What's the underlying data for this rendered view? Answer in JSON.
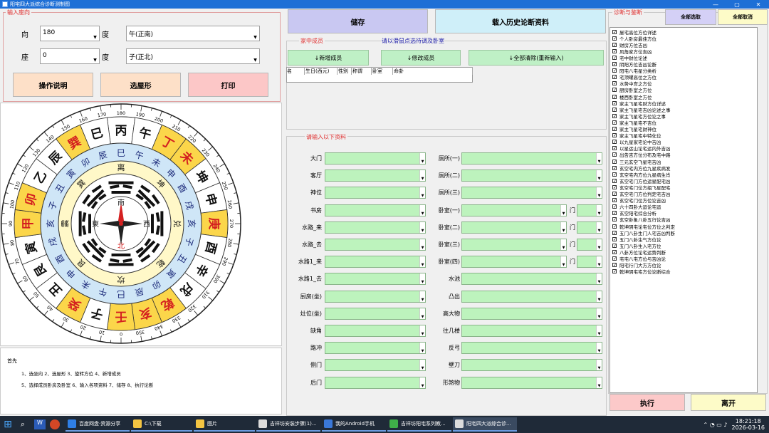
{
  "window": {
    "title": "阳宅四大派综合诊断测制图"
  },
  "input_group": {
    "title": "输入座向",
    "labels": [
      "向",
      "座"
    ],
    "du_label": "度",
    "xiang_value": "180",
    "xiang_dir": "午(正南)",
    "zuo_value": "0",
    "zuo_dir": "子(正北)"
  },
  "buttons": {
    "help": "操作说明",
    "shape": "选屋形",
    "print": "打印"
  },
  "toolbar": {
    "save": "储存",
    "load_history": "载入历史论断资料"
  },
  "family": {
    "title": "家中成员",
    "hint": "请以滑鼠点选待调及卧室",
    "add": "↓新增成员",
    "modify": "↓修改成员",
    "clear": "↓全部清除(重新输入)",
    "columns": [
      "名",
      "生日(西元)",
      "性别",
      "称谓",
      "卧室",
      "命卦"
    ]
  },
  "info": {
    "title": "请输入以下资料",
    "left": [
      "大门",
      "客厅",
      "神位",
      "书房",
      "水路_来",
      "水路_去",
      "水路1_来",
      "水路1_去",
      "厨房(坐)",
      "灶位(坐)",
      "缺角",
      "路冲",
      "侧门",
      "后门"
    ],
    "right": [
      "厕所(一)",
      "厕所(二)",
      "厕所(三)",
      "卧室(一)",
      "卧室(二)",
      "卧室(三)",
      "卧室(四)",
      "水池",
      "凸出",
      "高大物",
      "往几楼",
      "反弓",
      "壁刀",
      "形煞物"
    ],
    "door_label": "门"
  },
  "diagnosis": {
    "title": "诊断与鉴断",
    "select_all": "全部选取",
    "cancel_all": "全部取消",
    "run": "执行",
    "exit": "离开",
    "items": [
      "屋宅高位方位详述",
      "个人卧房最佳方位",
      "财房方位吉凶",
      "风角家方位吉凶",
      "宅中财位论述",
      "阴阳方位吉凶论断",
      "阳宅八宅星分类析",
      "宅顶曜高位之方位",
      "水势中宫之方位",
      "厨房卧室之方位",
      "楼西卧室之方位",
      "家主飞星宅财方位详述",
      "家主飞星宅吉凶论述之事",
      "家主飞星宅方位论之事",
      "家主飞星宅不吉位",
      "家主飞星宅财神位",
      "家主飞星宅中特化位",
      "以九星家宅论中吉凶",
      "以星运山论宅运内外吉凶",
      "出告吉方位分布及宅中路",
      "三元玄空飞星宅吉凶",
      "玄空宅内方位九星疾病发",
      "玄空宅内方位九星病生肖",
      "玄空宅门方位运星配宅凶",
      "玄空宅门位方组飞星配宅",
      "玄空宅门方位判定宅吉凶",
      "玄空宅门位方位论吉凶",
      "六十四卦大运论宅运",
      "玄空阳宅综合分析",
      "玄空卦象八卦五行论吉凶",
      "乾坤阴宅论宅位方位之判定",
      "五门八卦生门人宅吉凶判断",
      "五门八卦生气方位论",
      "五门八卦生入宅方位",
      "八卦方位论宅运势判断",
      "宅宅八宅方位与吉凶论",
      "阳宅行门大方方位论",
      "乾坤阴宅宅方位论断综合"
    ]
  },
  "notes": {
    "heading": "首先",
    "line1": "1、选坐向 2、选屋形 3、旋转方位 4、新增成员",
    "line2": "5、选择成员卧房及卧室 6、输入各项资料 7、储存 8、执行论断"
  },
  "compass": {
    "outer": [
      "丙",
      "午",
      "丁",
      "未",
      "坤",
      "申",
      "庚",
      "酉",
      "辛",
      "戌",
      "乾",
      "亥",
      "壬",
      "子",
      "癸",
      "丑",
      "艮",
      "寅",
      "甲",
      "卯",
      "乙",
      "辰",
      "巽",
      "巳"
    ],
    "ring2": [
      "巳",
      "午",
      "未",
      "申",
      "酉",
      "戌",
      "亥",
      "子",
      "丑",
      "寅",
      "卯",
      "辰",
      "巳",
      "午",
      "未",
      "申",
      "酉",
      "戌",
      "亥",
      "子",
      "丑",
      "寅",
      "卯",
      "辰"
    ],
    "ring3": [
      "离",
      "坤",
      "兑",
      "乾",
      "坎",
      "艮",
      "震",
      "巽"
    ],
    "center": {
      "north": "北",
      "south": "南",
      "east": "東",
      "west": "西"
    }
  },
  "taskbar": {
    "items": [
      "百度网盘·资源分享",
      "C:\\下载",
      "图片",
      "吉祥坊安装步骤(1)...",
      "我的Android手机",
      "吉祥坊阳宅系列教...",
      "阳宅四大派综合诊..."
    ],
    "time": "18:21:18",
    "date": "2026-03-16"
  }
}
